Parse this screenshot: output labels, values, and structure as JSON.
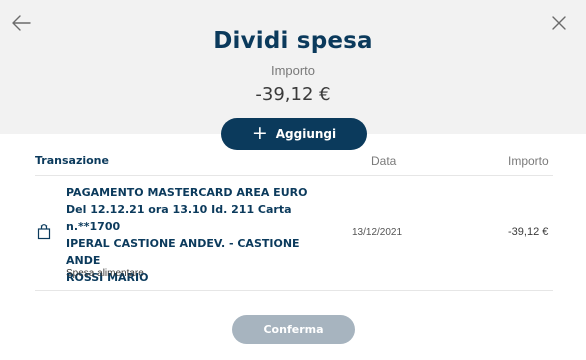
{
  "header": {
    "title": "Dividi spesa",
    "amount_label": "Importo",
    "amount_value": "-39,12 €"
  },
  "actions": {
    "add_label": "Aggiungi",
    "confirm_label": "Conferma"
  },
  "table": {
    "columns": [
      "Transazione",
      "Data",
      "Importo"
    ],
    "rows": [
      {
        "description_lines": [
          "PAGAMENTO MASTERCARD AREA EURO",
          "Del 12.12.21 ora 13.10 Id. 211 Carta n.**1700",
          "IPERAL CASTIONE ANDEV. - CASTIONE",
          "ANDE",
          "ROSSI MARIO"
        ],
        "category": "Spesa alimentare",
        "category_icon": "shopping-bag-icon",
        "date": "13/12/2021",
        "amount": "-39,12 €"
      }
    ]
  },
  "colors": {
    "primary": "#0b3a5c",
    "header_bg": "#f2f2f2",
    "disabled_button": "#a7b4bf"
  },
  "icons": {
    "back": "arrow-left-icon",
    "close": "close-icon"
  }
}
